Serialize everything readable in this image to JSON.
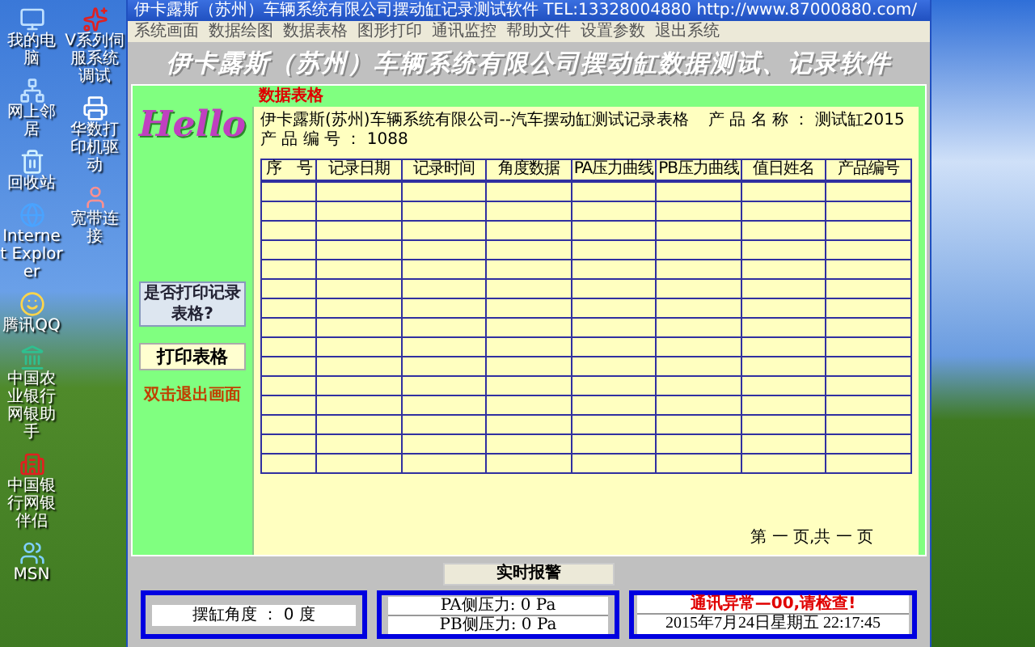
{
  "desktop": {
    "left_icons": [
      {
        "label": "我的电脑",
        "kind": "computer"
      },
      {
        "label": "网上邻居",
        "kind": "network"
      },
      {
        "label": "回收站",
        "kind": "trash"
      },
      {
        "label": "Internet Explorer",
        "kind": "globe"
      },
      {
        "label": "腾讯QQ",
        "kind": "penguin"
      },
      {
        "label": "中国农业银行网银助手",
        "kind": "bank"
      },
      {
        "label": "中国银行网银伴侣",
        "kind": "bank2"
      },
      {
        "label": "MSN",
        "kind": "people"
      }
    ],
    "right_icons": [
      {
        "label": "V系列伺服系统调试",
        "kind": "logo"
      },
      {
        "label": "华数打印机驱动",
        "kind": "printer"
      },
      {
        "label": "宽带连接",
        "kind": "person"
      }
    ]
  },
  "window": {
    "title": "伊卡露斯（苏州）车辆系统有限公司摆动缸记录测试软件 TEL:13328004880 http://www.87000880.com/",
    "menu": [
      "系统画面",
      "数据绘图",
      "数据表格",
      "图形打印",
      "通讯监控",
      "帮助文件",
      "设置参数",
      "退出系统"
    ],
    "banner": "伊卡露斯（苏州）车辆系统有限公司摆动缸数据测试、记录软件",
    "logo": "Hello",
    "question_button": "是否打印记录表格?",
    "print_button": "打印表格",
    "exit_hint": "双击退出画面",
    "panel_title": "数据表格",
    "document": {
      "company": "伊卡露斯(苏州)车辆系统有限公司--汽车摆动缸测试记录表格",
      "product_name": "产 品 名 称 ： 测试缸2015",
      "product_number": "产 品 编 号 ： 1088"
    },
    "table": {
      "columns": [
        "序　号",
        "记录日期",
        "记录时间",
        "角度数据",
        "PA压力曲线",
        "PB压力曲线",
        "值日姓名",
        "产品编号"
      ]
    },
    "page_info": "第 一 页,共 一 页",
    "alarm_button": "实时报警",
    "angle": "摆缸角度 ： 0 度",
    "pa": "PA侧压力:  0 Pa",
    "pb": "PB侧压力:  0 Pa",
    "alarm_message": "通讯异常—00,请检查!",
    "datetime": "2015年7月24日星期五   22:17:45"
  }
}
